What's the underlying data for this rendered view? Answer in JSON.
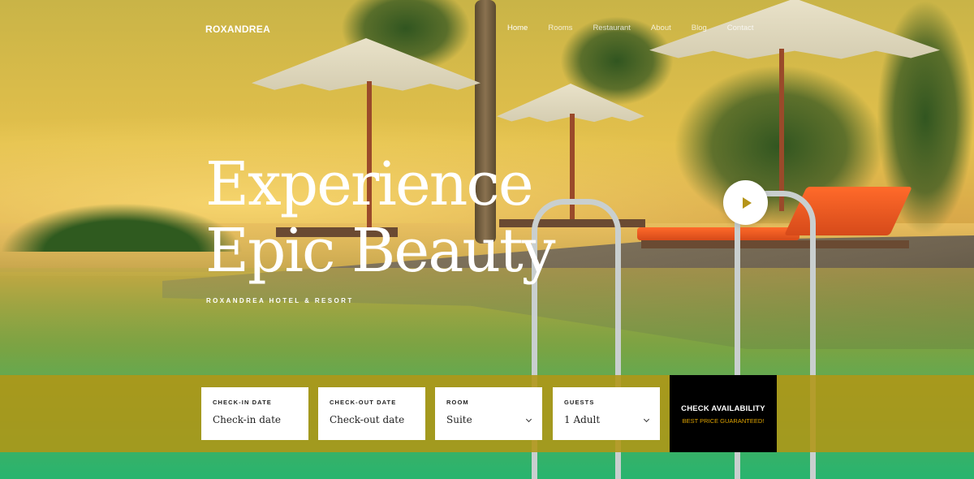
{
  "brand": {
    "name": "ROXANDREA"
  },
  "nav": {
    "items": [
      {
        "label": "Home",
        "active": true
      },
      {
        "label": "Rooms",
        "active": false
      },
      {
        "label": "Restaurant",
        "active": false
      },
      {
        "label": "About",
        "active": false
      },
      {
        "label": "Blog",
        "active": false
      },
      {
        "label": "Contact",
        "active": false
      }
    ]
  },
  "hero": {
    "headline_line1": "Experience",
    "headline_line2": "Epic Beauty",
    "subheading": "ROXANDREA HOTEL & RESORT",
    "play_icon": "play-icon"
  },
  "booking": {
    "checkin": {
      "label": "CHECK-IN DATE",
      "value": "Check-in date"
    },
    "checkout": {
      "label": "CHECK-OUT DATE",
      "value": "Check-out date"
    },
    "room": {
      "label": "ROOM",
      "value": "Suite"
    },
    "guests": {
      "label": "GUESTS",
      "value": "1 Adult"
    },
    "submit": {
      "label": "CHECK AVAILABILITY",
      "sublabel": "BEST PRICE GUARANTEED!"
    }
  },
  "colors": {
    "accent": "#b59419",
    "bar": "#b09616",
    "button": "#000000",
    "highlight": "#e0a400"
  }
}
